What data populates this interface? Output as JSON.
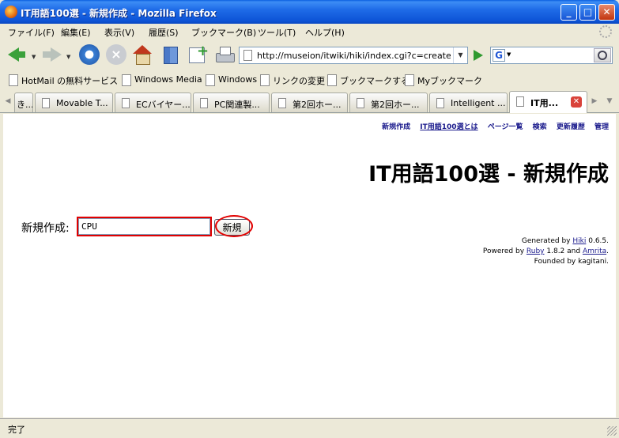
{
  "window": {
    "title": "IT用語100選 - 新規作成 - Mozilla Firefox"
  },
  "menu": {
    "items": [
      "ファイル(F)",
      "編集(E)",
      "表示(V)",
      "履歴(S)",
      "ブックマーク(B)",
      "ツール(T)",
      "ヘルプ(H)"
    ]
  },
  "navigation": {
    "url": "http://museion/itwiki/hiki/index.cgi?c=create",
    "search_engine": "G",
    "search_value": ""
  },
  "bookmarks": [
    "HotMail の無料サービス",
    "Windows Media",
    "Windows",
    "リンクの変更",
    "ブックマークする",
    "Myブックマーク"
  ],
  "tabs": [
    {
      "label": "き..."
    },
    {
      "label": "Movable T..."
    },
    {
      "label": "ECバイヤー..."
    },
    {
      "label": "PC関連製..."
    },
    {
      "label": "第2回ホー..."
    },
    {
      "label": "第2回ホー..."
    },
    {
      "label": "Intelligent ..."
    },
    {
      "label": "IT用...",
      "active": true
    }
  ],
  "page": {
    "top_links": [
      "新規作成",
      "IT用語100選とは",
      "ページ一覧",
      "検索",
      "更新履歴",
      "管理"
    ],
    "title": "IT用語100選 - 新規作成",
    "form_label": "新規作成:",
    "form_value": "CPU",
    "submit_label": "新規",
    "footer": {
      "generated_by": "Generated by",
      "hiki": "Hiki",
      "hiki_version": "0.6.5.",
      "powered_by": "Powered by",
      "ruby": "Ruby",
      "ruby_version": "1.8.2 and",
      "amrita": "Amrita",
      "period": ".",
      "founded_by": "Founded by kagitani."
    }
  },
  "status": {
    "text": "完了"
  },
  "colors": {
    "titlebar": "#0a5fe0",
    "highlight": "#e10000",
    "link": "#1a1a8c"
  },
  "icons": [
    "firefox-icon",
    "back-icon",
    "forward-icon",
    "reload-icon",
    "stop-icon",
    "home-icon",
    "bookmarks-icon",
    "new-tab-icon",
    "print-icon",
    "go-icon",
    "search-icon",
    "page-icon",
    "close-icon"
  ]
}
